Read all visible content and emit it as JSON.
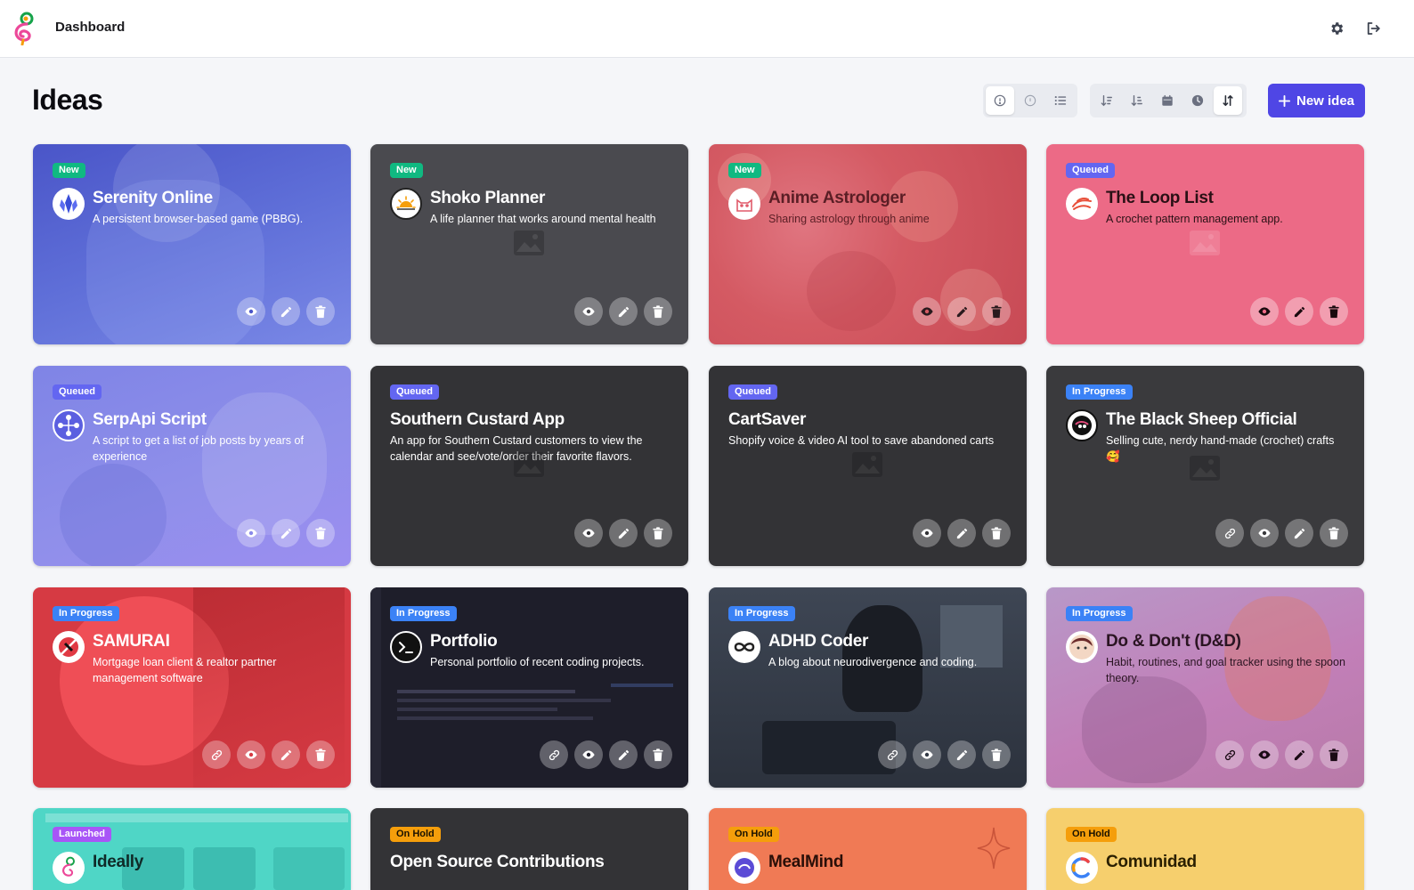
{
  "header": {
    "title": "Dashboard"
  },
  "main": {
    "title": "Ideas",
    "new_idea_label": "New idea"
  },
  "colors": {
    "accent": "#4f46e5",
    "status_new": "#10b981",
    "status_queued": "#6366f1",
    "status_in_progress": "#3b82f6",
    "status_launched": "#a855f7",
    "status_on_hold": "#f59e0b"
  },
  "ideas": [
    {
      "status": "New",
      "title": "Serenity Online",
      "description": "A persistent browser-based game (PBBG).",
      "icon": "crystal-icon"
    },
    {
      "status": "New",
      "title": "Shoko Planner",
      "description": "A life planner that works around mental health",
      "icon": "sun-icon"
    },
    {
      "status": "New",
      "title": "Anime Astrologer",
      "description": "Sharing astrology through anime",
      "icon": "cat-icon"
    },
    {
      "status": "Queued",
      "title": "The Loop List",
      "description": "A crochet pattern management app.",
      "icon": "yarn-icon"
    },
    {
      "status": "Queued",
      "title": "SerpApi Script",
      "description": "A script to get a list of job posts by years of experience",
      "icon": "network-icon"
    },
    {
      "status": "Queued",
      "title": "Southern Custard App",
      "description": "An app for Southern Custard customers to view the calendar and see/vote/order their favorite flavors.",
      "icon": ""
    },
    {
      "status": "Queued",
      "title": "CartSaver",
      "description": "Shopify voice & video AI tool to save abandoned carts",
      "icon": ""
    },
    {
      "status": "In Progress",
      "title": "The Black Sheep Official",
      "description": "Selling cute, nerdy hand-made (crochet) crafts 🥰",
      "icon": "sheep-icon"
    },
    {
      "status": "In Progress",
      "title": "SAMURAI",
      "description": "Mortgage loan client & realtor partner management software",
      "icon": "samurai-icon"
    },
    {
      "status": "In Progress",
      "title": "Portfolio",
      "description": "Personal portfolio of recent coding projects.",
      "icon": "terminal-icon"
    },
    {
      "status": "In Progress",
      "title": "ADHD Coder",
      "description": "A blog about neurodivergence and coding.",
      "icon": "infinity-icon"
    },
    {
      "status": "In Progress",
      "title": "Do & Don't (D&D)",
      "description": "Habit, routines, and goal tracker using the spoon theory.",
      "icon": "avatar-icon"
    },
    {
      "status": "Launched",
      "title": "Ideally",
      "description": "",
      "icon": "ideally-logo-icon"
    },
    {
      "status": "On Hold",
      "title": "Open Source Contributions",
      "description": "",
      "icon": ""
    },
    {
      "status": "On Hold",
      "title": "MealMind",
      "description": "",
      "icon": "brain-icon"
    },
    {
      "status": "On Hold",
      "title": "Comunidad",
      "description": "",
      "icon": "c-logo-icon"
    }
  ]
}
